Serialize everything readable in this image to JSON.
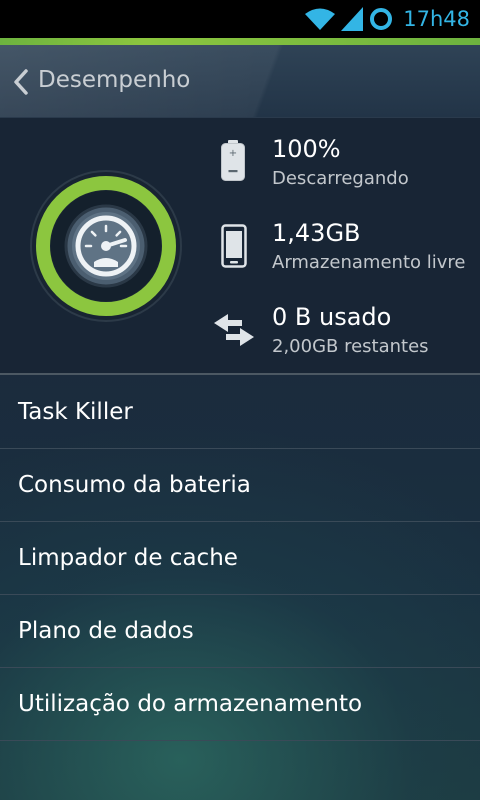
{
  "status_bar": {
    "time": "17h48",
    "icons": [
      "wifi-icon",
      "signal-icon",
      "sync-ring-icon"
    ],
    "accent_color": "#33b5e5"
  },
  "header": {
    "back_icon": "chevron-left-icon",
    "title": "Desempenho"
  },
  "gauge": {
    "icon": "speedometer-icon",
    "ring_color": "#8cc63f"
  },
  "stats": [
    {
      "icon": "battery-icon",
      "value": "100%",
      "label": "Descarregando"
    },
    {
      "icon": "phone-icon",
      "value": "1,43GB",
      "label": "Armazenamento livre"
    },
    {
      "icon": "data-transfer-icon",
      "value": "0 B usado",
      "label": "2,00GB restantes"
    }
  ],
  "menu": [
    {
      "label": "Task Killer"
    },
    {
      "label": "Consumo da bateria"
    },
    {
      "label": "Limpador de cache"
    },
    {
      "label": "Plano de dados"
    },
    {
      "label": "Utilização do armazenamento"
    }
  ]
}
